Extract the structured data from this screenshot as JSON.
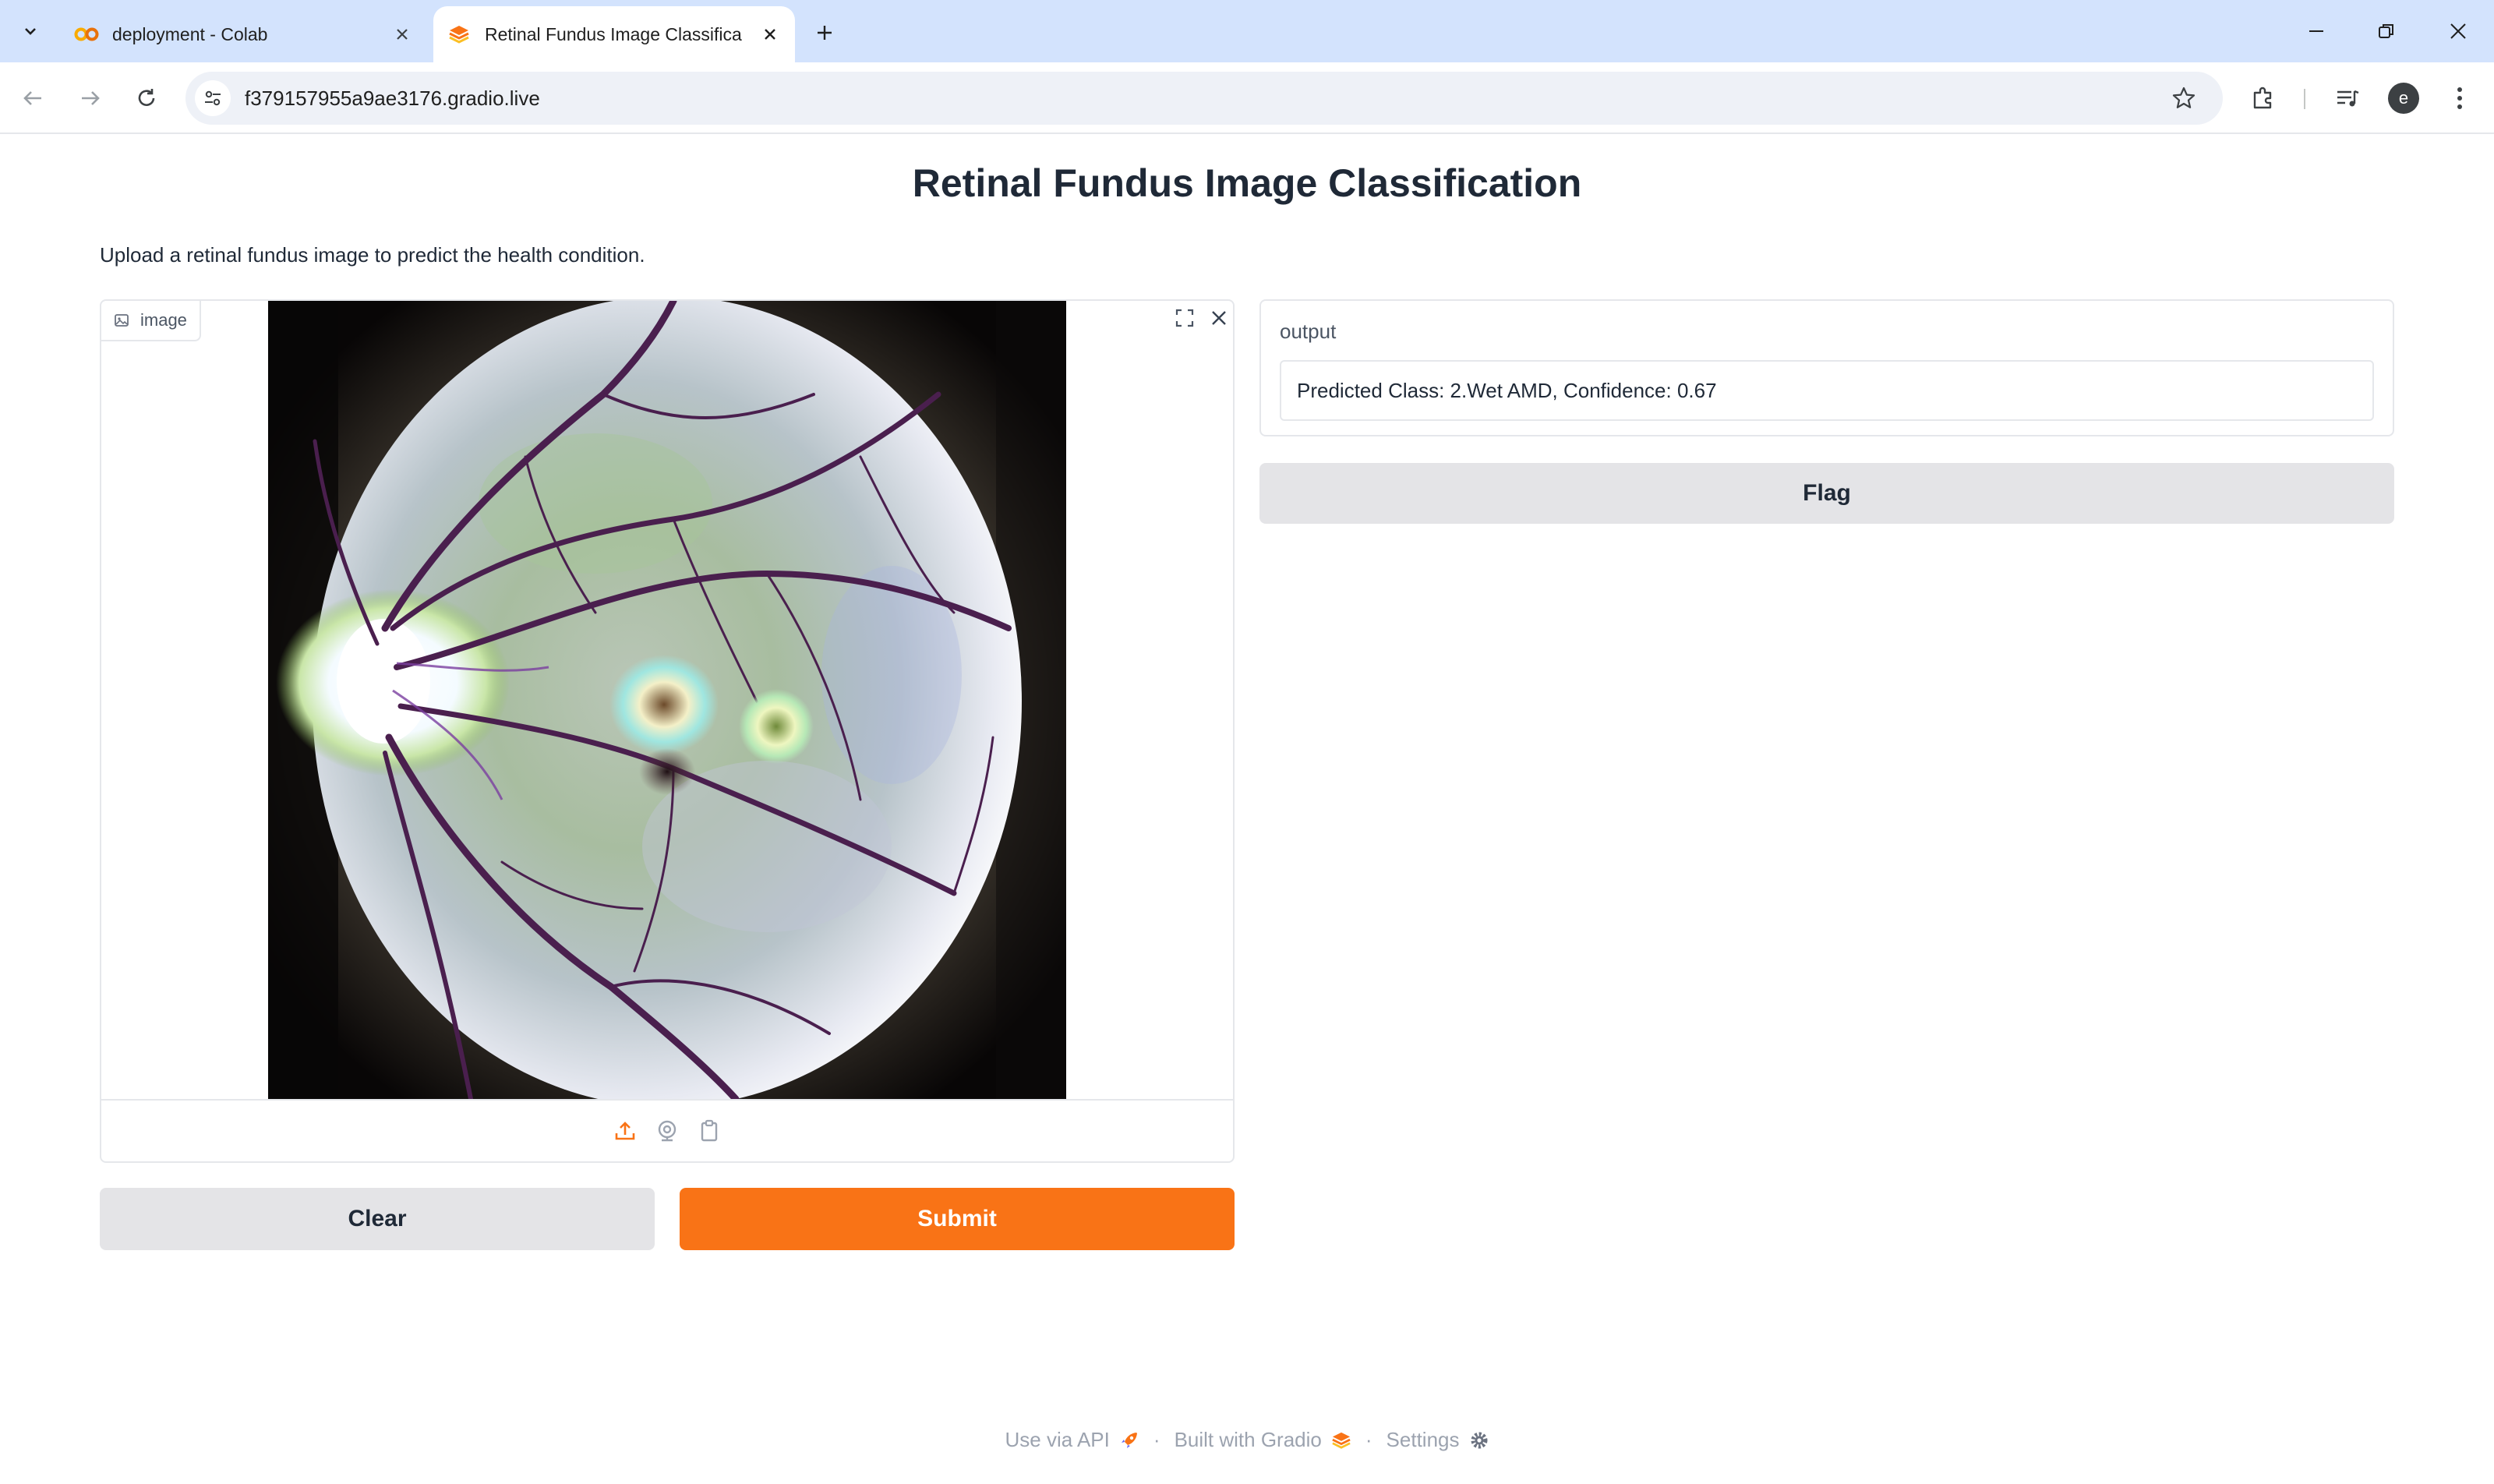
{
  "browser": {
    "tabs": [
      {
        "title": "deployment - Colab",
        "active": false,
        "favicon": "colab-icon"
      },
      {
        "title": "Retinal Fundus Image Classifica",
        "active": true,
        "favicon": "gradio-icon"
      }
    ],
    "url": "f379157955a9ae3176.gradio.live",
    "profile_initial": "e"
  },
  "app": {
    "title": "Retinal Fundus Image Classification",
    "description": "Upload a retinal fundus image to predict the health condition.",
    "image_input": {
      "label": "image"
    },
    "buttons": {
      "clear": "Clear",
      "submit": "Submit",
      "flag": "Flag"
    },
    "output": {
      "label": "output",
      "value": "Predicted Class: 2.Wet AMD, Confidence: 0.67"
    }
  },
  "footer": {
    "api": "Use via API",
    "built": "Built with Gradio",
    "settings": "Settings",
    "separator": "·"
  },
  "colors": {
    "accent": "#f97316",
    "tabbar": "#d3e3fd",
    "secondary_button": "#e4e4e7"
  }
}
